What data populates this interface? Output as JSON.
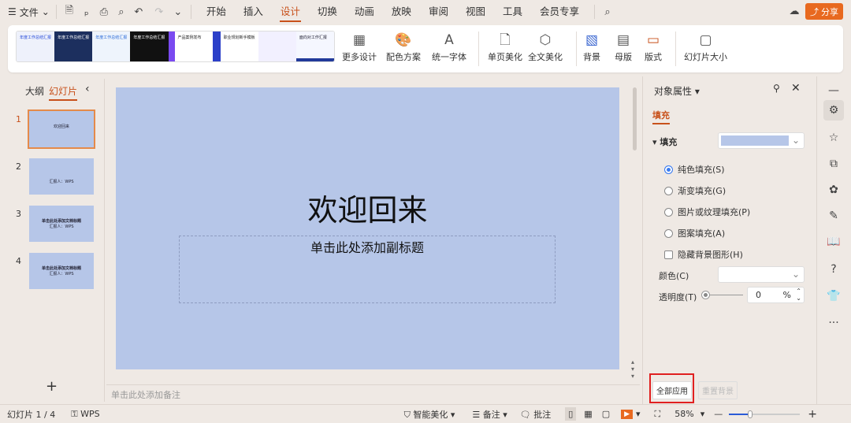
{
  "titlebar": {
    "menu": "文件",
    "tabs": [
      "开始",
      "插入",
      "设计",
      "切换",
      "动画",
      "放映",
      "审阅",
      "视图",
      "工具",
      "会员专享"
    ],
    "active_tab": "设计",
    "share": "分享"
  },
  "ribbon": {
    "templates": [
      "年度工作总结汇报",
      "年度工作总结汇报",
      "年度工作总结汇报",
      "年度工作总结汇报",
      "产品案例发布",
      "职业规划新手模板",
      "",
      "面向对工作汇报"
    ],
    "buttons": [
      "更多设计",
      "配色方案",
      "统一字体",
      "单页美化",
      "全文美化",
      "背景",
      "母版",
      "版式",
      "幻灯片大小"
    ]
  },
  "left_panel": {
    "tabs": [
      "大纲",
      "幻灯片"
    ],
    "active": "幻灯片",
    "slides": [
      {
        "num": "1",
        "title": "欢迎回来",
        "sub": ""
      },
      {
        "num": "2",
        "title": "",
        "sub": "汇报人：WPS"
      },
      {
        "num": "3",
        "title": "单击此处添加文档标题",
        "sub": "汇报人：WPS"
      },
      {
        "num": "4",
        "title": "单击此处添加文档标题",
        "sub": "汇报人：WPS"
      }
    ],
    "add": "+"
  },
  "slide": {
    "title": "欢迎回来",
    "subtitle": "单击此处添加副标题",
    "color": "#b6c6e8"
  },
  "notes": {
    "placeholder": "单击此处添加备注"
  },
  "panel": {
    "title": "对象属性",
    "tab": "填充",
    "section": "填充",
    "fill_options": [
      "纯色填充(S)",
      "渐变填充(G)",
      "图片或纹理填充(P)",
      "图案填充(A)"
    ],
    "selected": "纯色填充(S)",
    "hide_bg": "隐藏背景图形(H)",
    "color_label": "颜色(C)",
    "transparency_label": "透明度(T)",
    "transparency_value": "0",
    "percent": "%",
    "apply_all": "全部应用",
    "reset": "重置背景"
  },
  "status": {
    "slide": "幻灯片 1 / 4",
    "wps": "WPS",
    "beautify": "智能美化",
    "notes": "备注",
    "comment": "批注",
    "zoom": "58%",
    "zoom_fraction": 0.3
  }
}
